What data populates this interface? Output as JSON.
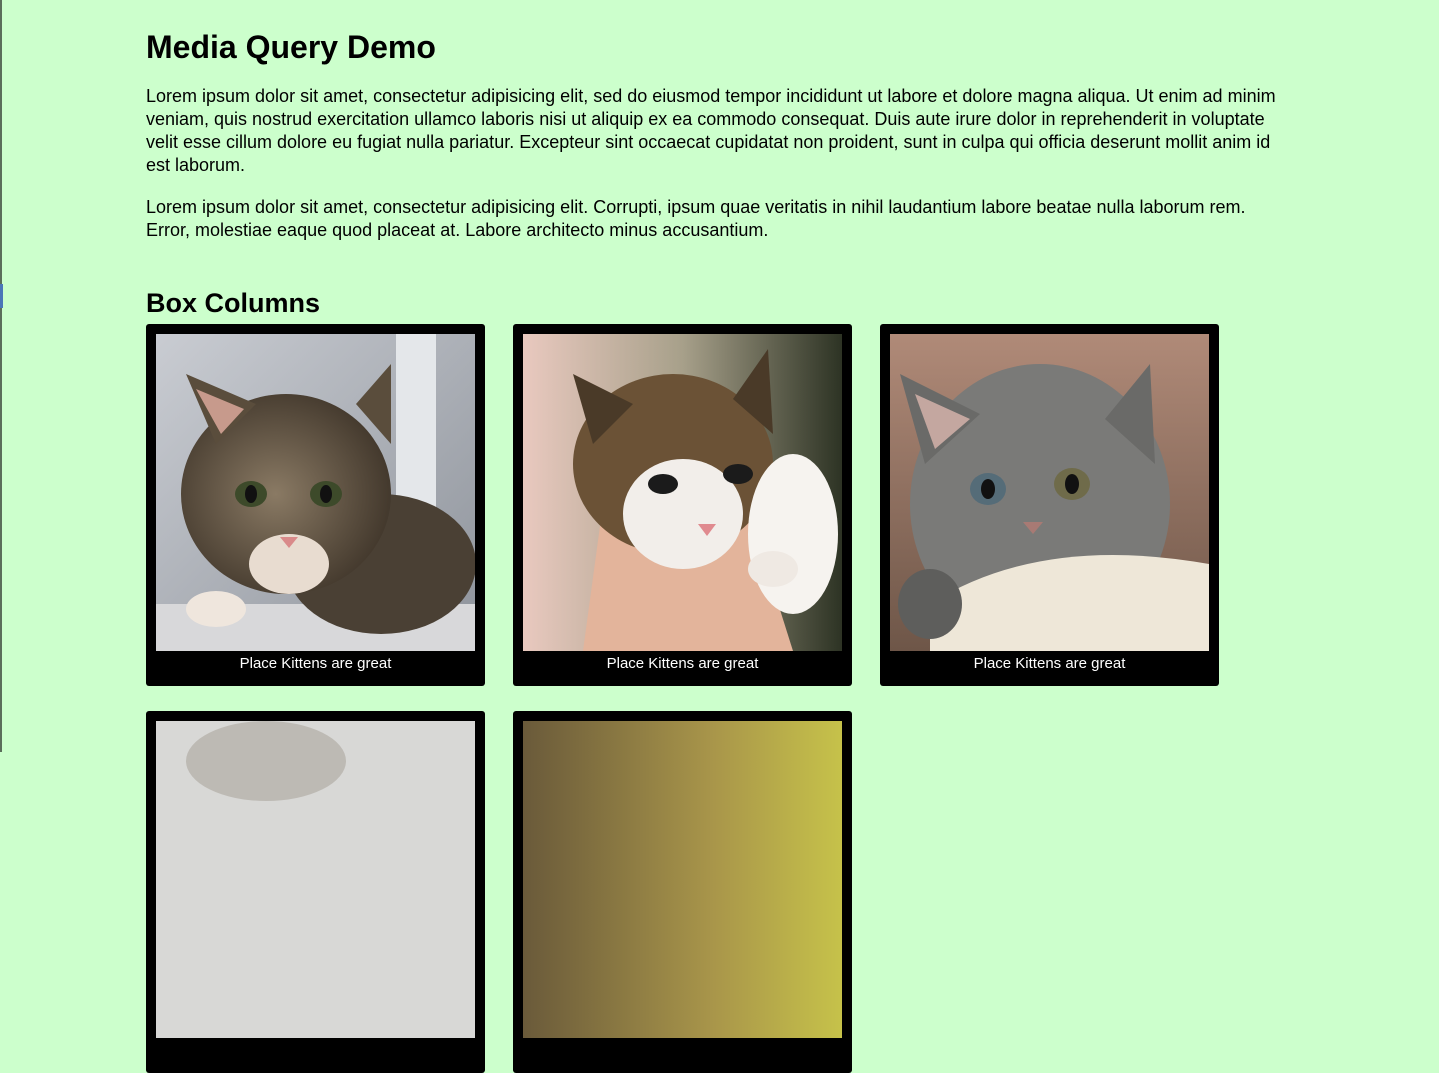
{
  "page": {
    "title": "Media Query Demo",
    "paragraphs": [
      "Lorem ipsum dolor sit amet, consectetur adipisicing elit, sed do eiusmod tempor incididunt ut labore et dolore magna aliqua. Ut enim ad minim veniam, quis nostrud exercitation ullamco laboris nisi ut aliquip ex ea commodo consequat. Duis aute irure dolor in reprehenderit in voluptate velit esse cillum dolore eu fugiat nulla pariatur. Excepteur sint occaecat cupidatat non proident, sunt in culpa qui officia deserunt mollit anim id est laborum.",
      "Lorem ipsum dolor sit amet, consectetur adipisicing elit. Corrupti, ipsum quae veritatis in nihil laudantium labore beatae nulla laborum rem. Error, molestiae eaque quod placeat at. Labore architecto minus accusantium."
    ],
    "section_heading": "Box Columns",
    "background_color": "#ccffcc",
    "card_color": "#000000"
  },
  "cards": [
    {
      "caption": "Place Kittens are great",
      "image": "tabby-kitten-photo"
    },
    {
      "caption": "Place Kittens are great",
      "image": "kitten-in-hand-photo"
    },
    {
      "caption": "Place Kittens are great",
      "image": "gray-kitten-photo"
    },
    {
      "caption": "",
      "image": "kitten-photo-partial"
    },
    {
      "caption": "",
      "image": "kitten-photo-partial"
    }
  ]
}
